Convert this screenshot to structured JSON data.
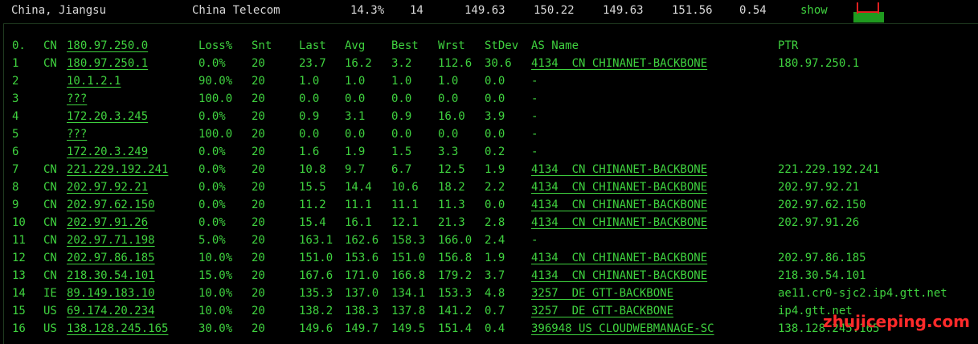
{
  "summary": {
    "location": "China, Jiangsu",
    "isp": "China Telecom",
    "loss": "14.3%",
    "count": "14",
    "v1": "149.63",
    "v2": "150.22",
    "v3": "149.63",
    "v4": "151.56",
    "v5": "0.54",
    "show_label": "show"
  },
  "table": {
    "header": {
      "hop": "0.",
      "cc": "CN",
      "host": "180.97.250.0",
      "loss": "Loss%",
      "snt": "Snt",
      "last": "Last",
      "avg": "Avg",
      "best": "Best",
      "wrst": "Wrst",
      "stdev": "StDev",
      "as": "AS Name",
      "ptr": "PTR"
    },
    "rows": [
      {
        "hop": "1",
        "cc": "CN",
        "host": "180.97.250.1",
        "loss": "0.0%",
        "snt": "20",
        "last": "23.7",
        "avg": "16.2",
        "best": "3.2",
        "wrst": "112.6",
        "stdev": "30.6",
        "as": "4134  CN CHINANET-BACKBONE",
        "ptr": "180.97.250.1"
      },
      {
        "hop": "2",
        "cc": "",
        "host": "10.1.2.1",
        "loss": "90.0%",
        "snt": "20",
        "last": "1.0",
        "avg": "1.0",
        "best": "1.0",
        "wrst": "1.0",
        "stdev": "0.0",
        "as": "-",
        "ptr": ""
      },
      {
        "hop": "3",
        "cc": "",
        "host": "???",
        "loss": "100.0",
        "snt": "20",
        "last": "0.0",
        "avg": "0.0",
        "best": "0.0",
        "wrst": "0.0",
        "stdev": "0.0",
        "as": "-",
        "ptr": ""
      },
      {
        "hop": "4",
        "cc": "",
        "host": "172.20.3.245",
        "loss": "0.0%",
        "snt": "20",
        "last": "0.9",
        "avg": "3.1",
        "best": "0.9",
        "wrst": "16.0",
        "stdev": "3.9",
        "as": "-",
        "ptr": ""
      },
      {
        "hop": "5",
        "cc": "",
        "host": "???",
        "loss": "100.0",
        "snt": "20",
        "last": "0.0",
        "avg": "0.0",
        "best": "0.0",
        "wrst": "0.0",
        "stdev": "0.0",
        "as": "-",
        "ptr": ""
      },
      {
        "hop": "6",
        "cc": "",
        "host": "172.20.3.249",
        "loss": "0.0%",
        "snt": "20",
        "last": "1.6",
        "avg": "1.9",
        "best": "1.5",
        "wrst": "3.3",
        "stdev": "0.2",
        "as": "-",
        "ptr": ""
      },
      {
        "hop": "7",
        "cc": "CN",
        "host": "221.229.192.241",
        "loss": "0.0%",
        "snt": "20",
        "last": "10.8",
        "avg": "9.7",
        "best": "6.7",
        "wrst": "12.5",
        "stdev": "1.9",
        "as": "4134  CN CHINANET-BACKBONE",
        "ptr": "221.229.192.241"
      },
      {
        "hop": "8",
        "cc": "CN",
        "host": "202.97.92.21",
        "loss": "0.0%",
        "snt": "20",
        "last": "15.5",
        "avg": "14.4",
        "best": "10.6",
        "wrst": "18.2",
        "stdev": "2.2",
        "as": "4134  CN CHINANET-BACKBONE",
        "ptr": "202.97.92.21"
      },
      {
        "hop": "9",
        "cc": "CN",
        "host": "202.97.62.150",
        "loss": "0.0%",
        "snt": "20",
        "last": "11.2",
        "avg": "11.1",
        "best": "11.1",
        "wrst": "11.3",
        "stdev": "0.0",
        "as": "4134  CN CHINANET-BACKBONE",
        "ptr": "202.97.62.150"
      },
      {
        "hop": "10",
        "cc": "CN",
        "host": "202.97.91.26",
        "loss": "0.0%",
        "snt": "20",
        "last": "15.4",
        "avg": "16.1",
        "best": "12.1",
        "wrst": "21.3",
        "stdev": "2.8",
        "as": "4134  CN CHINANET-BACKBONE",
        "ptr": "202.97.91.26"
      },
      {
        "hop": "11",
        "cc": "CN",
        "host": "202.97.71.198",
        "loss": "5.0%",
        "snt": "20",
        "last": "163.1",
        "avg": "162.6",
        "best": "158.3",
        "wrst": "166.0",
        "stdev": "2.4",
        "as": "-",
        "ptr": ""
      },
      {
        "hop": "12",
        "cc": "CN",
        "host": "202.97.86.185",
        "loss": "10.0%",
        "snt": "20",
        "last": "151.0",
        "avg": "153.6",
        "best": "151.0",
        "wrst": "156.8",
        "stdev": "1.9",
        "as": "4134  CN CHINANET-BACKBONE",
        "ptr": "202.97.86.185"
      },
      {
        "hop": "13",
        "cc": "CN",
        "host": "218.30.54.101",
        "loss": "15.0%",
        "snt": "20",
        "last": "167.6",
        "avg": "171.0",
        "best": "166.8",
        "wrst": "179.2",
        "stdev": "3.7",
        "as": "4134  CN CHINANET-BACKBONE",
        "ptr": "218.30.54.101"
      },
      {
        "hop": "14",
        "cc": "IE",
        "host": "89.149.183.10",
        "loss": "10.0%",
        "snt": "20",
        "last": "135.3",
        "avg": "137.0",
        "best": "134.1",
        "wrst": "153.3",
        "stdev": "4.8",
        "as": "3257  DE GTT-BACKBONE",
        "ptr": "ae11.cr0-sjc2.ip4.gtt.net"
      },
      {
        "hop": "15",
        "cc": "US",
        "host": "69.174.20.234",
        "loss": "10.0%",
        "snt": "20",
        "last": "138.2",
        "avg": "138.3",
        "best": "137.8",
        "wrst": "141.2",
        "stdev": "0.7",
        "as": "3257  DE GTT-BACKBONE",
        "ptr": "ip4.gtt.net"
      },
      {
        "hop": "16",
        "cc": "US",
        "host": "138.128.245.165",
        "loss": "30.0%",
        "snt": "20",
        "last": "149.6",
        "avg": "149.7",
        "best": "149.5",
        "wrst": "151.4",
        "stdev": "0.4",
        "as": "396948 US CLOUDWEBMANAGE-SC",
        "ptr": "138.128.245.165"
      }
    ]
  },
  "watermark": "zhujiceping.com",
  "colors": {
    "text_green": "#3fd23f",
    "summary_text": "#d8d8d8",
    "background": "#000000",
    "watermark": "#ff2a2a",
    "spark_bar": "#1f9a1f",
    "spark_marker": "#e02020"
  }
}
